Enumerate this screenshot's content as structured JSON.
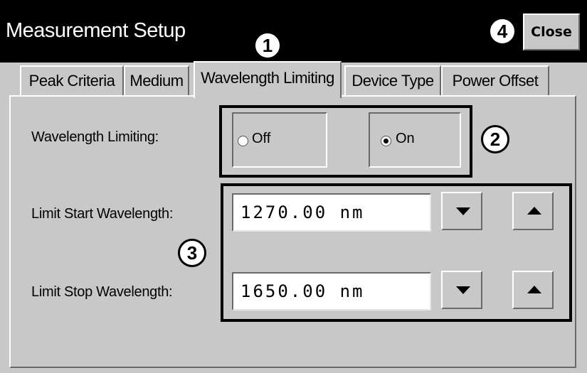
{
  "window": {
    "title": "Measurement Setup",
    "close_label": "Close"
  },
  "tabs": [
    {
      "label": "Peak Criteria",
      "active": false
    },
    {
      "label": "Medium",
      "active": false
    },
    {
      "label": "Wavelength Limiting",
      "active": true
    },
    {
      "label": "Device Type",
      "active": false
    },
    {
      "label": "Power Offset",
      "active": false
    }
  ],
  "form": {
    "wavelength_limiting": {
      "label": "Wavelength Limiting:",
      "options": [
        {
          "label": "Off",
          "selected": false
        },
        {
          "label": "On",
          "selected": true
        }
      ]
    },
    "start": {
      "label": "Limit Start Wavelength:",
      "value": "1270.00 nm"
    },
    "stop": {
      "label": "Limit Stop Wavelength:",
      "value": "1650.00 nm"
    }
  },
  "callouts": [
    "1",
    "2",
    "3",
    "4"
  ],
  "icons": {
    "decrement": "triangle-down-icon",
    "increment": "triangle-up-icon"
  }
}
